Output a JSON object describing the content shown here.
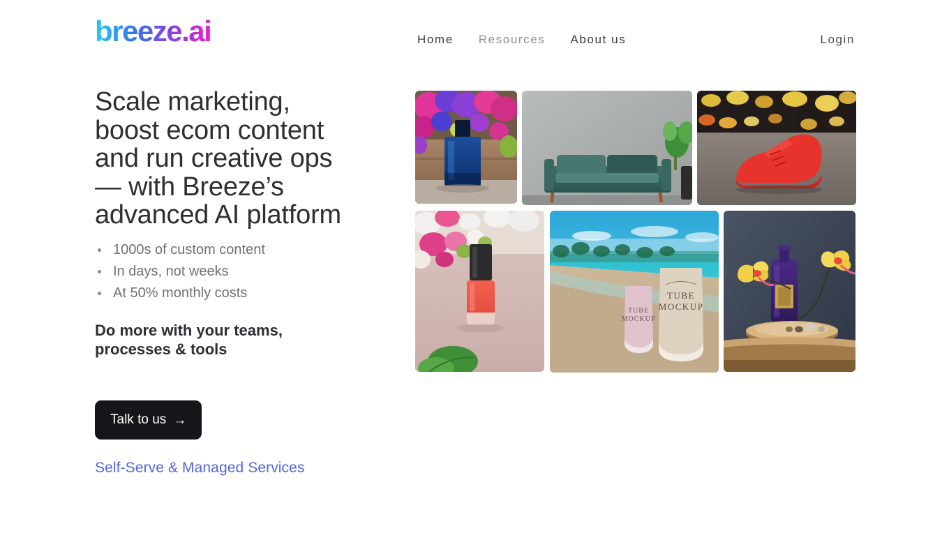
{
  "brand": {
    "logo_text": "breeze.ai"
  },
  "nav": {
    "items": [
      {
        "label": "Home",
        "muted": false
      },
      {
        "label": "Resources",
        "muted": true
      },
      {
        "label": "About us",
        "muted": false
      }
    ],
    "login_label": "Login"
  },
  "hero": {
    "headline": "Scale marketing, boost ecom content and run creative ops — with Breeze’s advanced AI platform",
    "bullets": [
      "1000s of custom content",
      "In days, not weeks",
      "At 50% monthly costs"
    ],
    "subheadline": "Do more with your teams, processes & tools",
    "cta_label": "Talk to us",
    "cta_arrow": "→",
    "services_link": "Self-Serve & Managed Services"
  },
  "gallery": {
    "items": [
      {
        "name": "perfume-bottle-with-flowers",
        "alt": "Dark blue perfume bottle on wood with pink and purple flowers"
      },
      {
        "name": "teal-velvet-sofa",
        "alt": "Teal velvet sofa against a gray wall with a plant"
      },
      {
        "name": "red-sneaker",
        "alt": "Red high-top sneaker on pavement with city bokeh lights"
      },
      {
        "name": "coral-nail-polish",
        "alt": "Coral nail polish bottle with pink flowers and green leaf"
      },
      {
        "name": "tube-mockups-on-beach",
        "alt": "Two cosmetic tubes on a tropical beach",
        "label_line1": "TUBE",
        "label_line2": "MOCKUP"
      },
      {
        "name": "purple-bottle-with-orchids",
        "alt": "Purple bottle with gold label on wood slab with yellow orchids"
      }
    ]
  },
  "colors": {
    "logo_gradient_start": "#2ec8ee",
    "logo_gradient_mid1": "#3478e8",
    "logo_gradient_mid2": "#8b3fe0",
    "logo_gradient_end": "#e81fd0",
    "cta_background": "#16161a",
    "link_blue": "#5566e0",
    "heading_text": "#2e2e33",
    "body_text": "#6f6f78"
  }
}
